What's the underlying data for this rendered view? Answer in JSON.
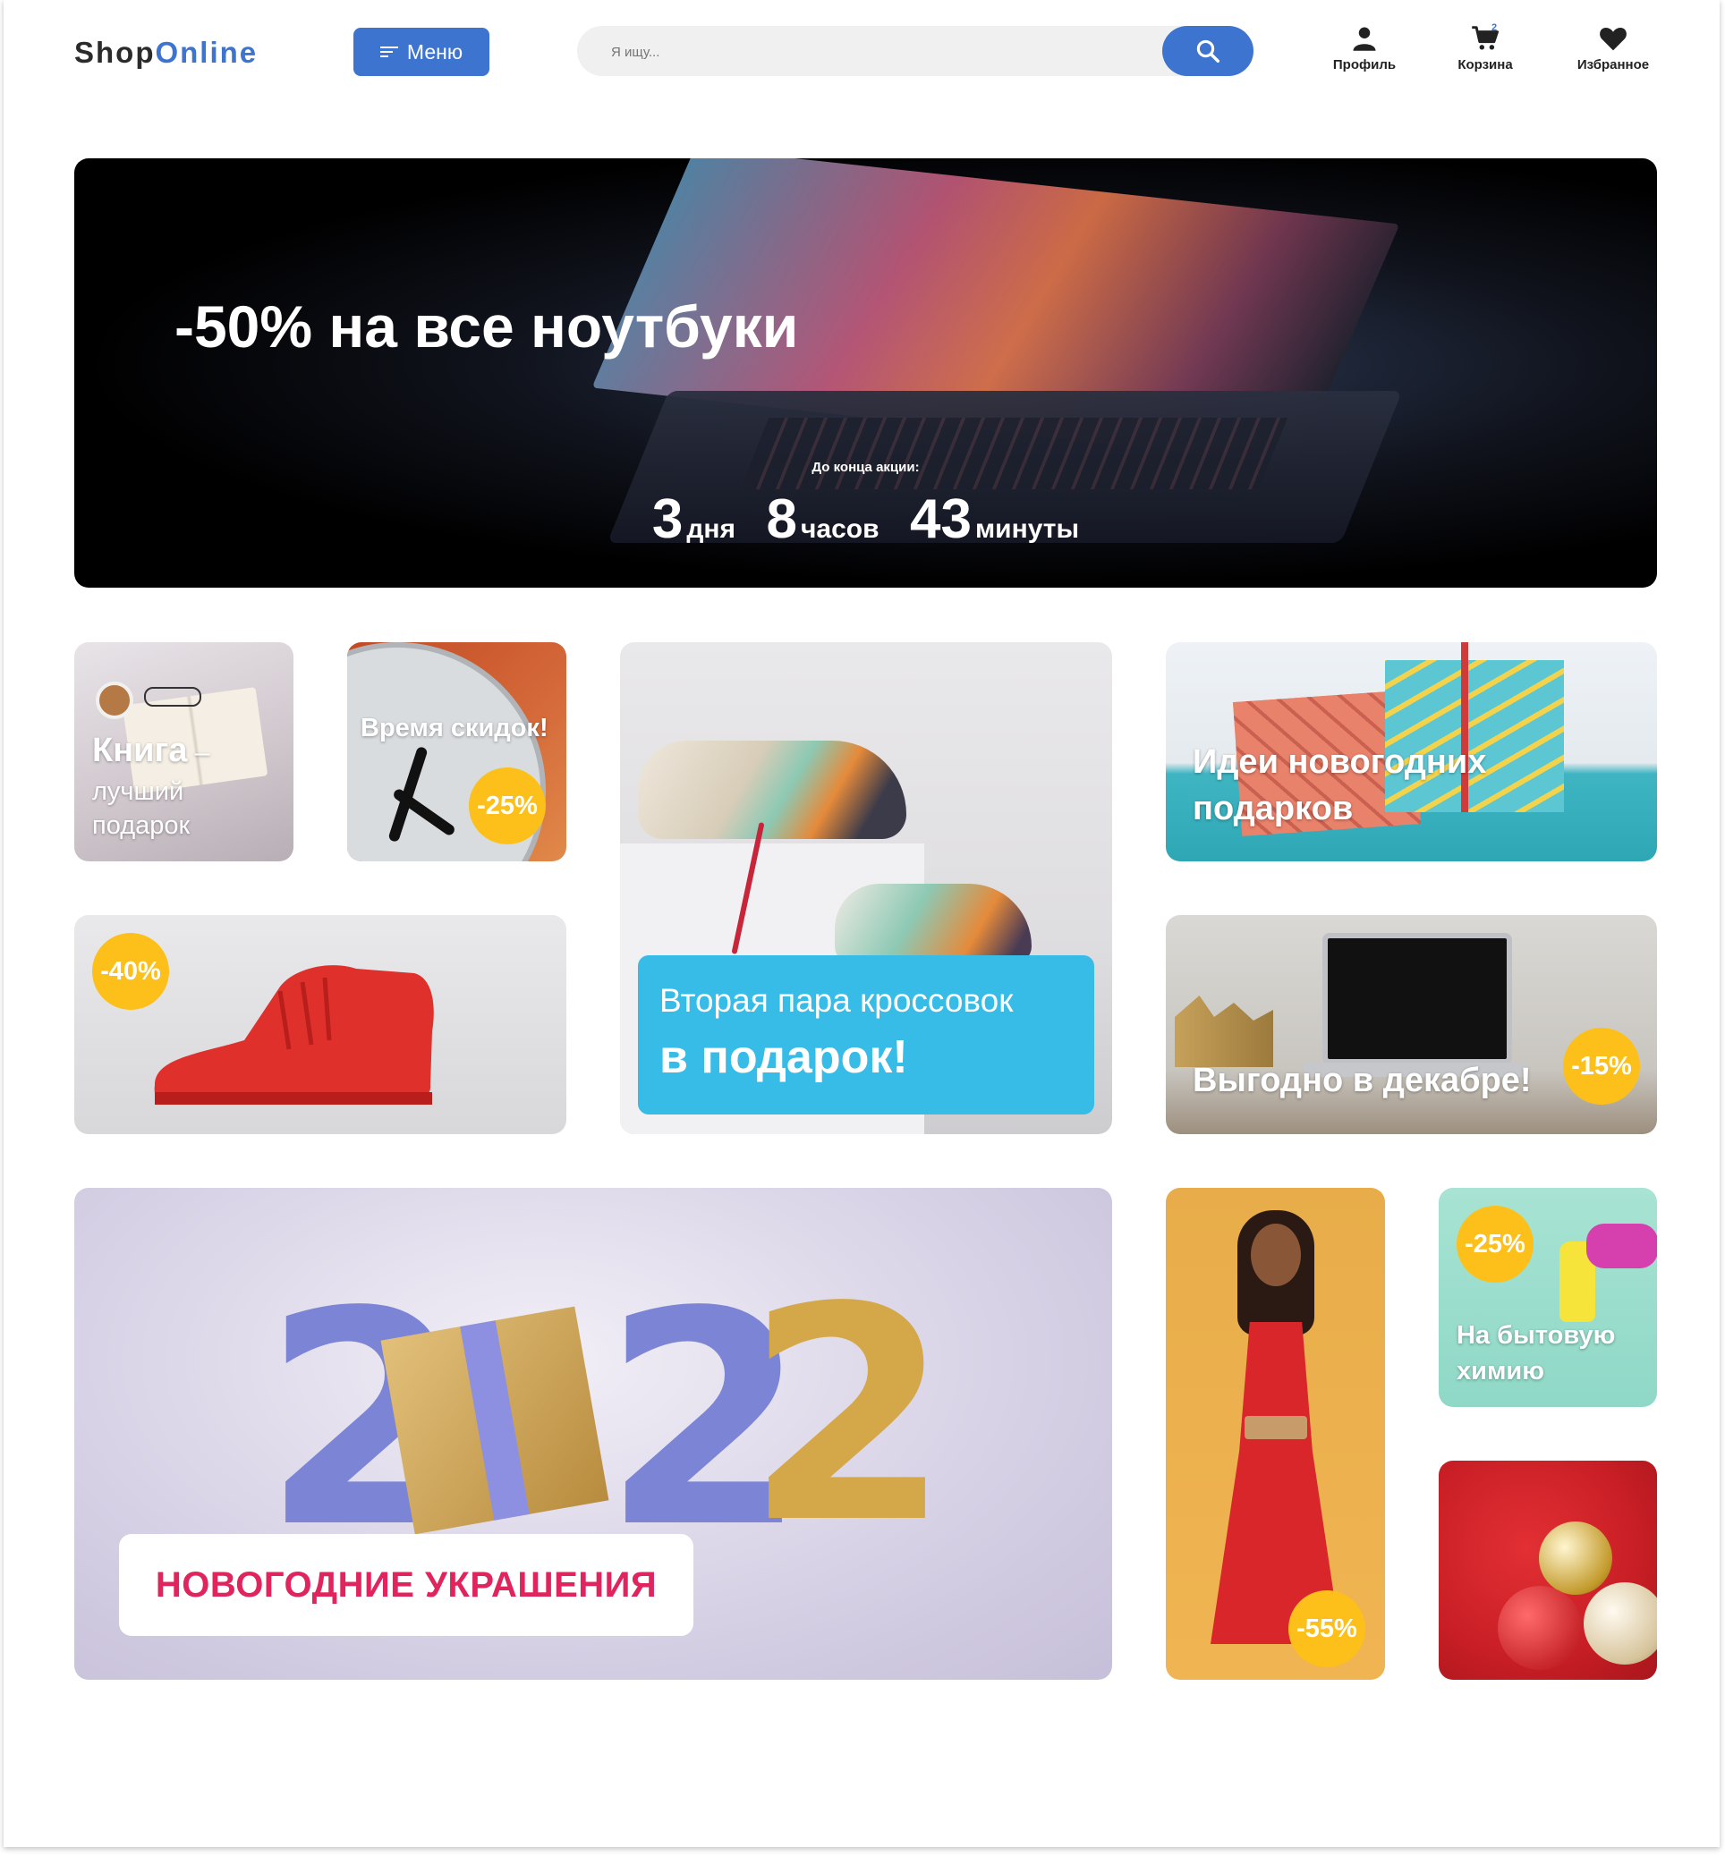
{
  "header": {
    "logo_part1": "Shop",
    "logo_part2": "Online",
    "menu_label": "Меню",
    "search_placeholder": "Я ищу...",
    "profile_label": "Профиль",
    "cart_label": "Корзина",
    "cart_count": "2",
    "favorites_label": "Избранное"
  },
  "hero": {
    "title": "-50% на все ноутбуки",
    "countdown_label": "До конца акции:",
    "days": "3",
    "days_unit": "дня",
    "hours": "8",
    "hours_unit": "часов",
    "minutes": "43",
    "minutes_unit": "минуты"
  },
  "cards": {
    "book": {
      "title": "Книга",
      "dash": " –",
      "line2": "лучший",
      "line3": "подарок"
    },
    "clock": {
      "title": "Время скидок!",
      "badge": "-25%"
    },
    "sneakers_gift": {
      "line1": "Вторая пара кроссовок",
      "line2": "в подарок!"
    },
    "gift_ideas": {
      "line1": "Идеи новогодних",
      "line2": "подарков"
    },
    "red_shoe": {
      "badge": "-40%"
    },
    "december": {
      "title": "Выгодно в декабре!",
      "badge": "-15%"
    },
    "new_year": {
      "label": "НОВОГОДНИЕ УКРАШЕНИЯ"
    },
    "dress": {
      "badge": "-55%"
    },
    "household": {
      "badge": "-25%",
      "line1": "На бытовую",
      "line2": "химию"
    }
  },
  "colors": {
    "brand": "#3d74cf",
    "badge": "#fdc01a",
    "promo_panel": "#37bce8",
    "new_year_text": "#e0245e"
  }
}
